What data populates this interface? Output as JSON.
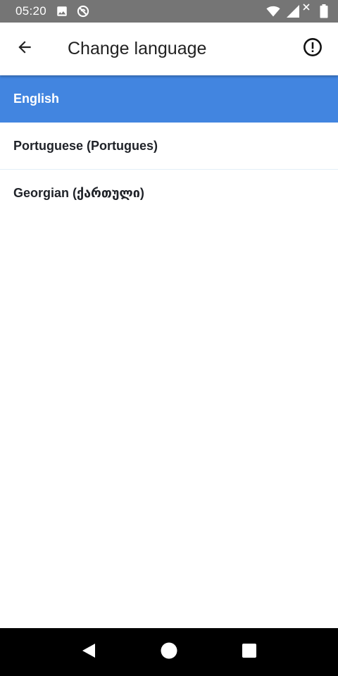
{
  "status_bar": {
    "time": "05:20",
    "icons_left": [
      "image-icon",
      "sync-disabled-icon"
    ],
    "icons_right": [
      "wifi-icon",
      "signal-icon",
      "battery-icon"
    ]
  },
  "app_bar": {
    "title": "Change language",
    "back_icon": "arrow-back-icon",
    "info_icon": "info-alert-icon"
  },
  "languages": [
    {
      "label": "English",
      "selected": true
    },
    {
      "label": "Portuguese (Portugues)",
      "selected": false
    },
    {
      "label": "Georgian (ქართული)",
      "selected": false
    }
  ],
  "colors": {
    "status_bar": "#757575",
    "selected_row": "#4285e0",
    "nav_bar": "#000000"
  },
  "nav_bar": {
    "icons": [
      "nav-back-icon",
      "nav-home-icon",
      "nav-recents-icon"
    ]
  }
}
